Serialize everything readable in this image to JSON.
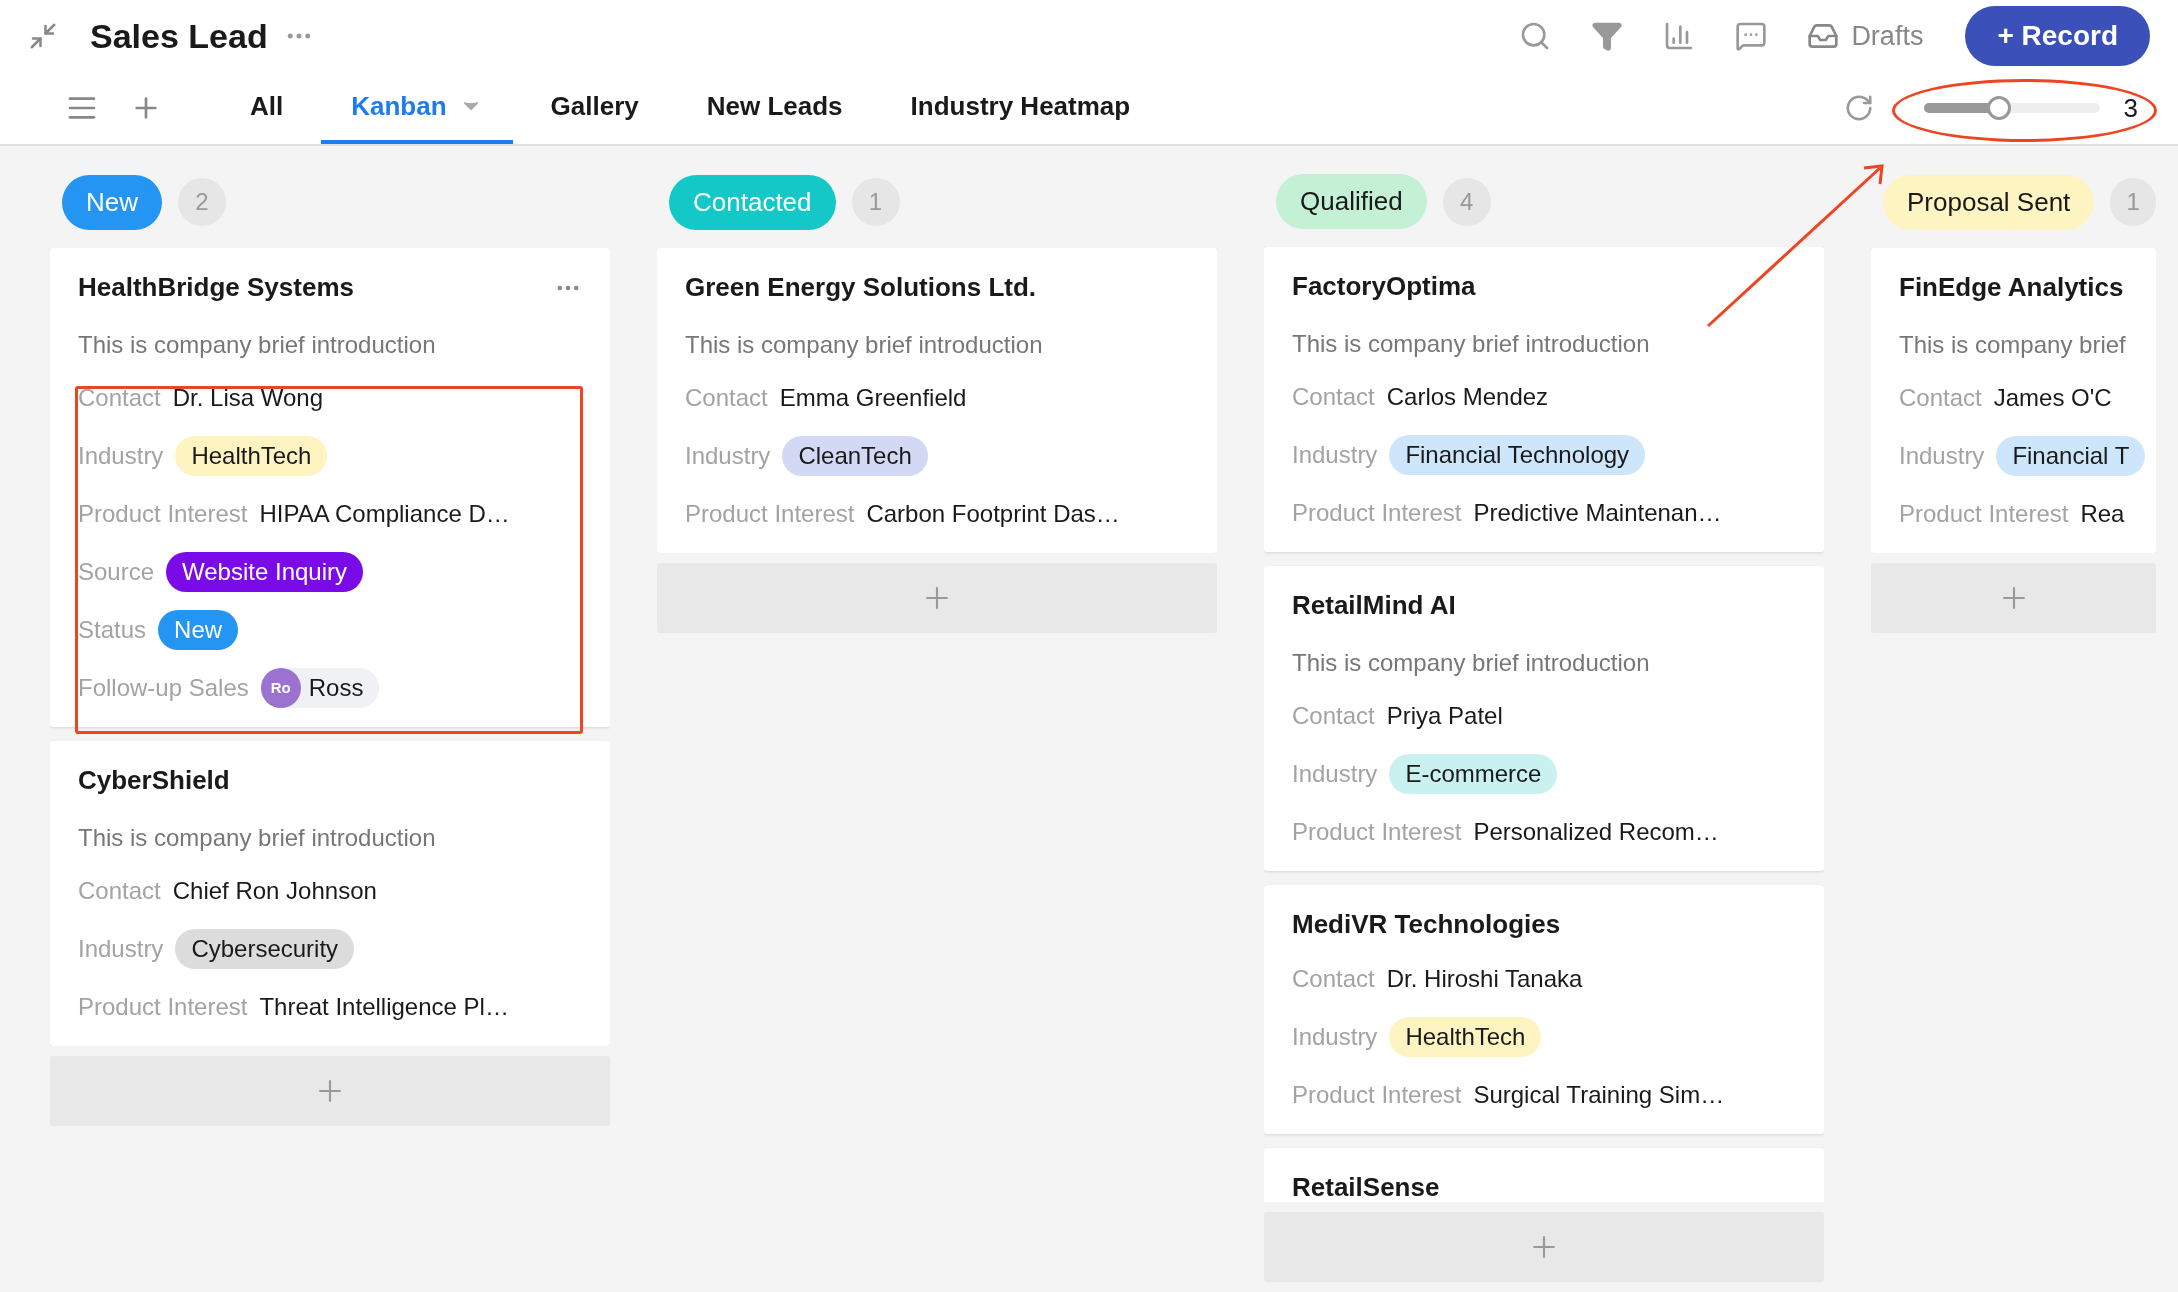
{
  "header": {
    "title": "Sales Lead",
    "drafts": "Drafts",
    "record_button": "+ Record"
  },
  "tabs": [
    {
      "label": "All",
      "selected": false,
      "has_menu": false
    },
    {
      "label": "Kanban",
      "selected": true,
      "has_menu": true
    },
    {
      "label": "Gallery",
      "selected": false,
      "has_menu": false
    },
    {
      "label": "New Leads",
      "selected": false,
      "has_menu": false
    },
    {
      "label": "Industry Heatmap",
      "selected": false,
      "has_menu": false
    }
  ],
  "zoom_slider": {
    "level": 0.43,
    "reading": "3"
  },
  "columns": [
    {
      "name": "New",
      "color": "#2495f3",
      "count": "2",
      "cards": [
        {
          "title": "HealthBridge Systems",
          "has_menu": true,
          "intro": "This is company brief introduction",
          "fields": [
            {
              "kind": "text",
              "label": "Contact",
              "value": "Dr. Lisa Wong"
            },
            {
              "kind": "tag",
              "label": "Industry",
              "value": "HealthTech",
              "color": "#fdf4c2"
            },
            {
              "kind": "text",
              "label": "Product Interest",
              "value": "HIPAA Compliance D…"
            },
            {
              "kind": "tag",
              "label": "Source",
              "value": "Website Inquiry",
              "color": "#7a0be8"
            },
            {
              "kind": "tag",
              "label": "Status",
              "value": "New",
              "color": "#2495f3"
            },
            {
              "kind": "person",
              "label": "Follow-up Sales",
              "initials": "Ro",
              "value": "Ross"
            }
          ]
        },
        {
          "title": "CyberShield",
          "has_menu": false,
          "intro": "This is company brief introduction",
          "fields": [
            {
              "kind": "text",
              "label": "Contact",
              "value": "Chief Ron Johnson"
            },
            {
              "kind": "tag",
              "label": "Industry",
              "value": "Cybersecurity",
              "color": "#dcdcdc"
            },
            {
              "kind": "text",
              "label": "Product Interest",
              "value": "Threat Intelligence Pl…"
            }
          ]
        }
      ]
    },
    {
      "name": "Contacted",
      "color": "#14c8c8",
      "count": "1",
      "cards": [
        {
          "title": "Green Energy Solutions Ltd.",
          "has_menu": false,
          "intro": "This is company brief introduction",
          "fields": [
            {
              "kind": "text",
              "label": "Contact",
              "value": "Emma Greenfield"
            },
            {
              "kind": "tag",
              "label": "Industry",
              "value": "CleanTech",
              "color": "#d3d9f5"
            },
            {
              "kind": "text",
              "label": "Product Interest",
              "value": "Carbon Footprint Das…"
            }
          ]
        }
      ]
    },
    {
      "name": "Qualified",
      "color": "#c4f0d6",
      "count": "4",
      "cards": [
        {
          "title": "FactoryOptima",
          "has_menu": false,
          "intro": "This is company brief introduction",
          "fields": [
            {
              "kind": "text",
              "label": "Contact",
              "value": "Carlos Mendez"
            },
            {
              "kind": "tag",
              "label": "Industry",
              "value": "Financial Technology",
              "color": "#cde6fb"
            },
            {
              "kind": "text",
              "label": "Product Interest",
              "value": "Predictive Maintenan…"
            }
          ]
        },
        {
          "title": "RetailMind AI",
          "has_menu": false,
          "intro": "This is company brief introduction",
          "fields": [
            {
              "kind": "text",
              "label": "Contact",
              "value": "Priya Patel"
            },
            {
              "kind": "tag",
              "label": "Industry",
              "value": "E-commerce",
              "color": "#c8f1f0"
            },
            {
              "kind": "text",
              "label": "Product Interest",
              "value": "Personalized Recom…"
            }
          ]
        },
        {
          "title": "MediVR Technologies",
          "has_menu": false,
          "fields": [
            {
              "kind": "text",
              "label": "Contact",
              "value": "Dr. Hiroshi Tanaka"
            },
            {
              "kind": "tag",
              "label": "Industry",
              "value": "HealthTech",
              "color": "#fdf4c2"
            },
            {
              "kind": "text",
              "label": "Product Interest",
              "value": "Surgical Training Sim…"
            }
          ]
        },
        {
          "title": "RetailSense",
          "has_menu": false
        }
      ]
    },
    {
      "name": "Proposal Sent",
      "color": "#fdf4c2",
      "count": "1",
      "cards": [
        {
          "title": "FinEdge Analytics",
          "has_menu": false,
          "intro": "This is company brief",
          "fields": [
            {
              "kind": "text",
              "label": "Contact",
              "value": "James O'C"
            },
            {
              "kind": "tag",
              "label": "Industry",
              "value": "Financial T",
              "color": "#cde6fb"
            },
            {
              "kind": "text",
              "label": "Product Interest",
              "value": "Rea"
            }
          ]
        }
      ]
    }
  ]
}
